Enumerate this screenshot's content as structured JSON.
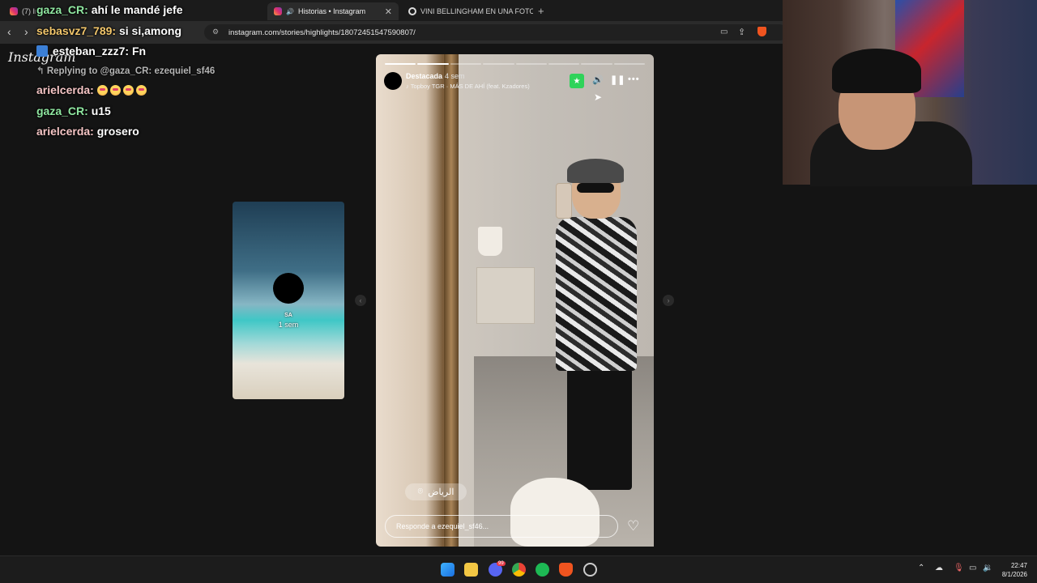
{
  "browser": {
    "tabs": [
      {
        "label": "(7) In",
        "active": false
      },
      {
        "label": "Historias • Instagram",
        "active": true
      },
      {
        "label": "VINI BELLINGHAM EN UNA FOTO - B",
        "active": false
      }
    ],
    "url": "instagram.com/stories/highlights/18072451547590807/"
  },
  "instagram": {
    "logo_text": "Instagram"
  },
  "chat": {
    "messages": [
      {
        "user": "gaza_CR:",
        "text": "ahí le mandé jefe"
      },
      {
        "user": "sebasvz7_789:",
        "text": "si si,among"
      },
      {
        "user": "esteban_zzz7:",
        "text": "Fn"
      },
      {
        "user": "arielcerda:",
        "text": ""
      },
      {
        "user": "gaza_CR:",
        "text": "u15"
      },
      {
        "user": "arielcerda:",
        "text": "grosero"
      }
    ],
    "reply_note": "Replying to @gaza_CR: ezequiel_sf46"
  },
  "side_story": {
    "username": "SA",
    "time": "1 sem"
  },
  "story": {
    "username": "Destacada",
    "time": "4 sem",
    "song": "Topboy TGR · MÁS DE AHÍ (feat. Kzadores)",
    "location": "الرياض",
    "reply_placeholder": "Responde a ezequiel_sf46...",
    "progress_segments": 8,
    "progress_filled": 2
  },
  "taskbar": {
    "time": "22:47",
    "date": "8/1/2026",
    "discord_badge": "99"
  },
  "colors": {
    "favorite_green": "#2fd35a",
    "chat_user_green": "#8fe6a0"
  }
}
